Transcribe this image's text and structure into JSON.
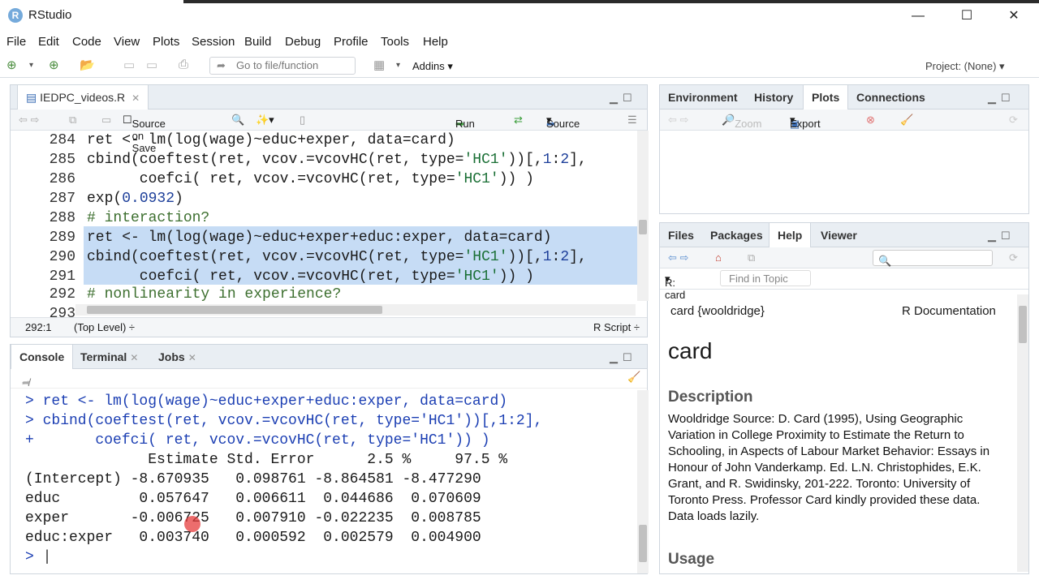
{
  "app": {
    "title": "RStudio",
    "icon": "R"
  },
  "menu": [
    "File",
    "Edit",
    "Code",
    "View",
    "Plots",
    "Session",
    "Build",
    "Debug",
    "Profile",
    "Tools",
    "Help"
  ],
  "toolbar": {
    "goto_placeholder": "Go to file/function",
    "addins": "Addins",
    "project": "Project: (None)"
  },
  "editor": {
    "tab": "IEDPC_videos.R",
    "source_on_save": "Source on Save",
    "run": "Run",
    "source": "Source",
    "lines": [
      {
        "n": "284",
        "t": "ret <- lm(log(wage)~educ+exper, data=card)"
      },
      {
        "n": "285",
        "t": "cbind(coeftest(ret, vcov.=vcovHC(ret, type='HC1'))[,1:2],"
      },
      {
        "n": "286",
        "t": "      coefci( ret, vcov.=vcovHC(ret, type='HC1')) )"
      },
      {
        "n": "287",
        "t": "exp(0.0932)"
      },
      {
        "n": "288",
        "t": "# interaction?"
      },
      {
        "n": "289",
        "t": "ret <- lm(log(wage)~educ+exper+educ:exper, data=card)"
      },
      {
        "n": "290",
        "t": "cbind(coeftest(ret, vcov.=vcovHC(ret, type='HC1'))[,1:2],"
      },
      {
        "n": "291",
        "t": "      coefci( ret, vcov.=vcovHC(ret, type='HC1')) )"
      },
      {
        "n": "292",
        "t": "# nonlinearity in experience?"
      },
      {
        "n": "293",
        "t": ""
      }
    ],
    "status_pos": "292:1",
    "status_scope": "(Top Level) ÷",
    "status_type": "R Script ÷"
  },
  "console": {
    "tabs": [
      "Console",
      "Terminal",
      "Jobs"
    ],
    "path": "~/",
    "lines": [
      "> ret <- lm(log(wage)~educ+exper+educ:exper, data=card)",
      "> cbind(coeftest(ret, vcov.=vcovHC(ret, type='HC1'))[,1:2],",
      "+       coefci( ret, vcov.=vcovHC(ret, type='HC1')) )",
      "              Estimate Std. Error      2.5 %     97.5 %",
      "(Intercept) -8.670935   0.098761 -8.864581 -8.477290",
      "educ         0.057647   0.006611  0.044686  0.070609",
      "exper       -0.006725   0.007910 -0.022235  0.008785",
      "educ:exper   0.003740   0.000592  0.002579  0.004900",
      "> "
    ]
  },
  "env": {
    "tabs": [
      "Environment",
      "History",
      "Plots",
      "Connections"
    ],
    "zoom": "Zoom",
    "export": "Export"
  },
  "files": {
    "tabs": [
      "Files",
      "Packages",
      "Help",
      "Viewer"
    ],
    "topic_scope": "R: card",
    "find_placeholder": "Find in Topic"
  },
  "help": {
    "ref": "card {wooldridge}",
    "rdoc": "R Documentation",
    "title": "card",
    "h_desc": "Description",
    "desc": "Wooldridge Source: D. Card (1995), Using Geographic Variation in College Proximity to Estimate the Return to Schooling, in Aspects of Labour Market Behavior: Essays in Honour of John Vanderkamp. Ed. L.N. Christophides, E.K. Grant, and R. Swidinsky, 201-222. Toronto: University of Toronto Press. Professor Card kindly provided these data. Data loads lazily.",
    "h_usage": "Usage"
  }
}
